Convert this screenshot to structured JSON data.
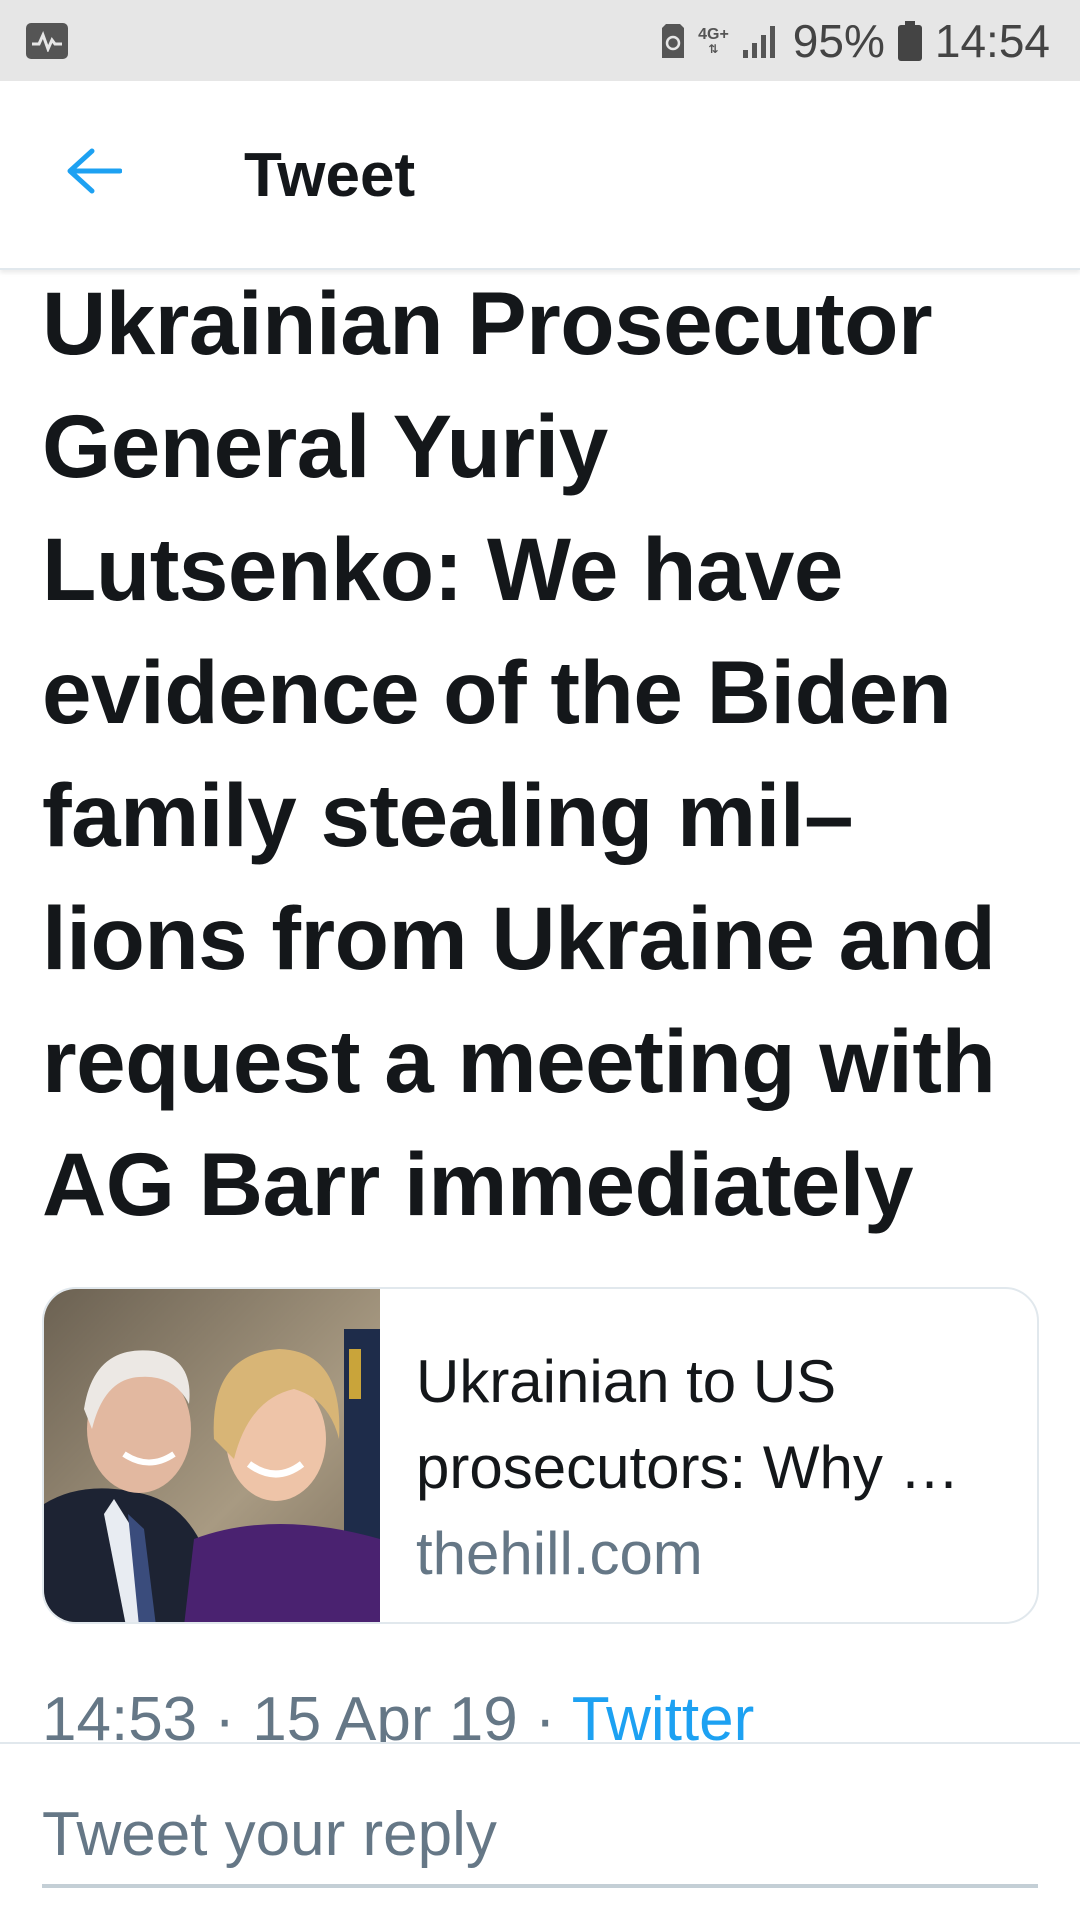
{
  "status_bar": {
    "network": "4G+",
    "battery_percent": "95%",
    "time": "14:54"
  },
  "header": {
    "title": "Tweet"
  },
  "tweet": {
    "text": "Ukrainian Prosecutor General Yuriy Lutsenko: We have evidence of the Biden family stealing mil– lions from Ukraine and request a meeting with AG Barr immediately",
    "meta": {
      "time": "14:53",
      "date": "15 Apr 19",
      "source": "Twitter",
      "separator": " · "
    }
  },
  "link_card": {
    "title": "Ukrainian to US prosecutors: Why …",
    "domain": "thehill.com"
  },
  "reply": {
    "placeholder": "Tweet your reply"
  },
  "colors": {
    "accent": "#1da1f2",
    "text": "#14171a",
    "secondary": "#657786",
    "border": "#e1e8ed"
  }
}
